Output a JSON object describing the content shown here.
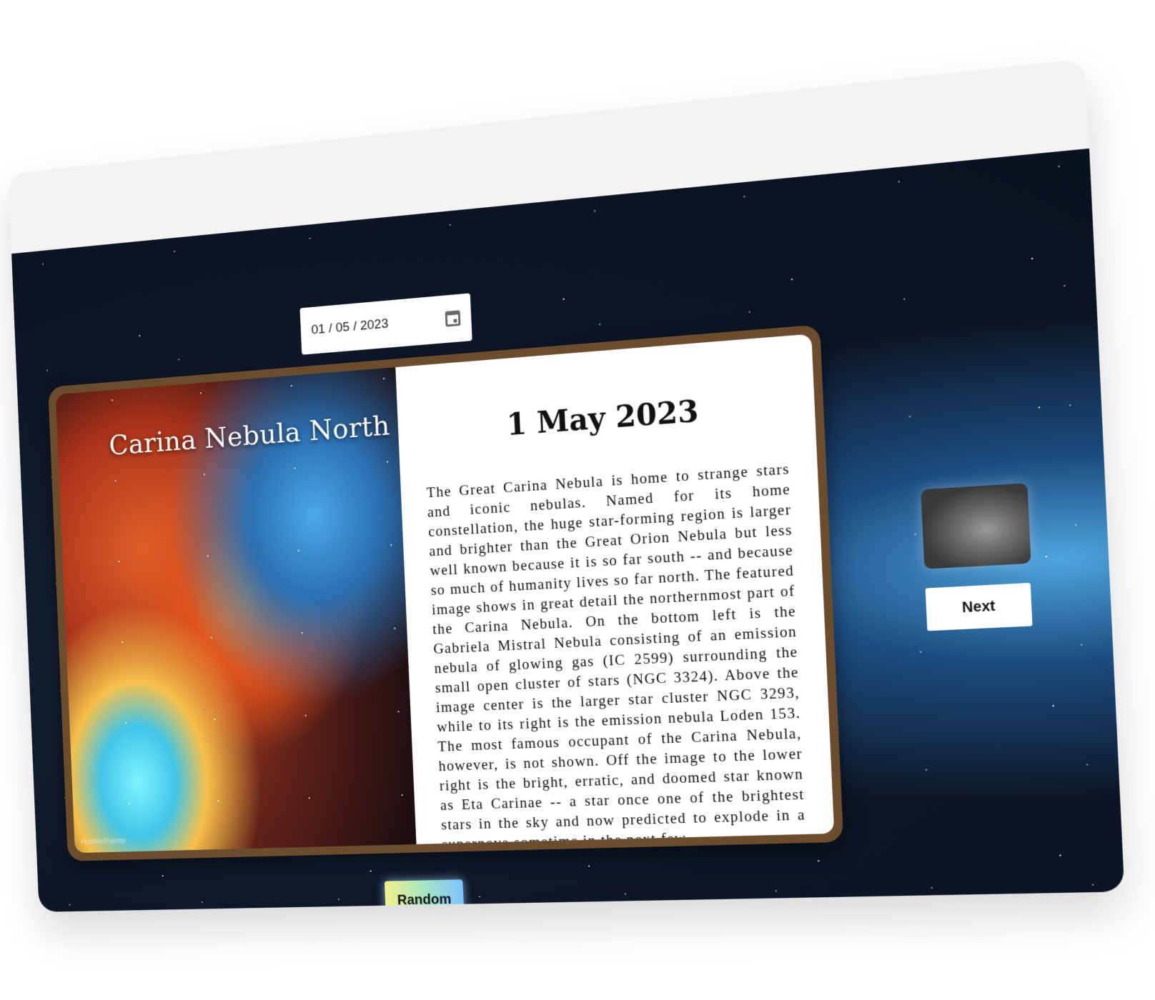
{
  "date_picker": {
    "value": "01 / 05 / 2023",
    "icon": "calendar-icon"
  },
  "apod": {
    "image_title": "Carina Nebula North",
    "image_credit": "Hubble/Palette",
    "date_heading": "1 May 2023",
    "explanation": "The Great Carina Nebula is home to strange stars and iconic nebulas. Named for its home constellation, the huge star-forming region is larger and brighter than the Great Orion Nebula but less well known because it is so far south -- and because so much of humanity lives so far north. The featured image shows in great detail the northernmost part of the Carina Nebula. On the bottom left is the Gabriela Mistral Nebula consisting of an emission nebula of glowing gas (IC 2599) surrounding the small open cluster of stars (NGC 3324). Above the image center is the larger star cluster NGC 3293, while to its right is the emission nebula Loden 153. The most famous occupant of the Carina Nebula, however, is not shown. Off the image to the lower right is the bright, erratic, and doomed star known as Eta Carinae -- a star once one of the brightest stars in the sky and now predicted to explode in a supernova sometime in the next few"
  },
  "navigation": {
    "next_label": "Next",
    "random_label": "Random"
  },
  "colors": {
    "book_frame": "#6b4d2e",
    "space_bg": "#0d1626",
    "random_gradient": [
      "#f5f08c",
      "#7fc3ff"
    ]
  }
}
